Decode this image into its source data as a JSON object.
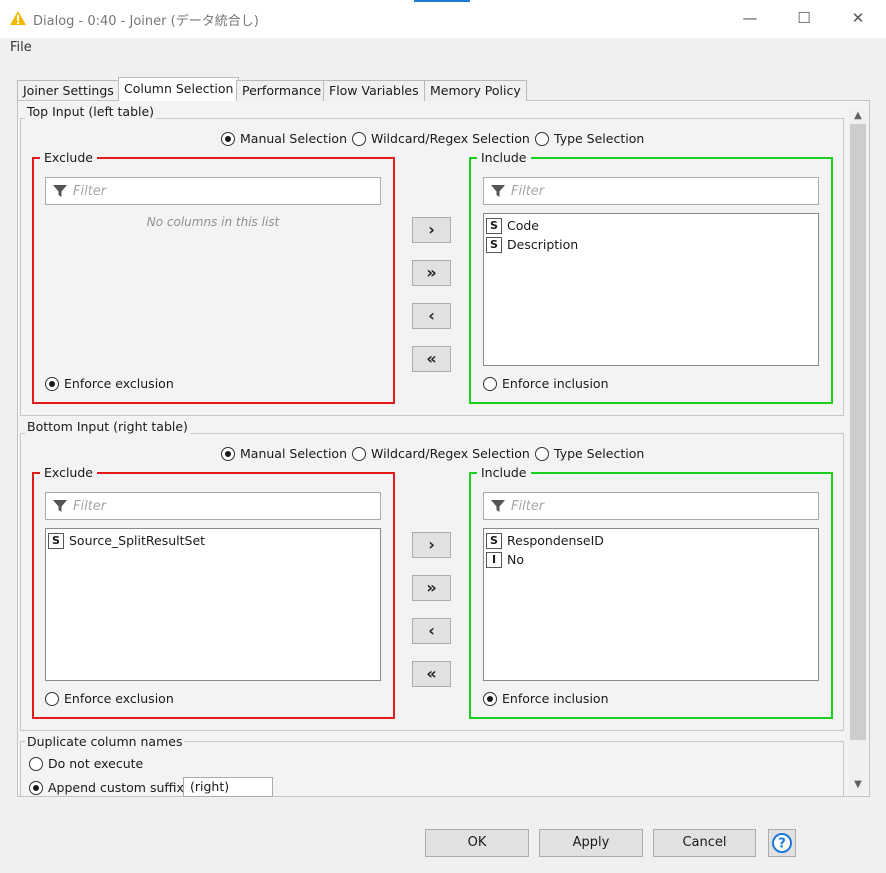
{
  "window": {
    "title": "Dialog - 0:40 - Joiner (データ統合し)",
    "min": "—",
    "max": "☐",
    "close": "✕"
  },
  "menu": {
    "file": "File"
  },
  "tabs": [
    "Joiner Settings",
    "Column Selection",
    "Performance",
    "Flow Variables",
    "Memory Policy"
  ],
  "active_tab": "Column Selection",
  "top": {
    "title": "Top Input (left table)",
    "mode_options": [
      "Manual Selection",
      "Wildcard/Regex Selection",
      "Type Selection"
    ],
    "selected_mode": "Manual Selection",
    "exclude": {
      "label": "Exclude",
      "filter_placeholder": "Filter",
      "empty_message": "No columns in this list",
      "items": [],
      "enforce_label": "Enforce exclusion",
      "enforce_selected": true
    },
    "include": {
      "label": "Include",
      "filter_placeholder": "Filter",
      "items": [
        {
          "type": "S",
          "name": "Code"
        },
        {
          "type": "S",
          "name": "Description"
        }
      ],
      "enforce_label": "Enforce inclusion",
      "enforce_selected": false
    }
  },
  "bottom": {
    "title": "Bottom Input (right table)",
    "mode_options": [
      "Manual Selection",
      "Wildcard/Regex Selection",
      "Type Selection"
    ],
    "selected_mode": "Manual Selection",
    "exclude": {
      "label": "Exclude",
      "filter_placeholder": "Filter",
      "items": [
        {
          "type": "S",
          "name": "Source_SplitResultSet"
        }
      ],
      "enforce_label": "Enforce exclusion",
      "enforce_selected": false
    },
    "include": {
      "label": "Include",
      "filter_placeholder": "Filter",
      "items": [
        {
          "type": "S",
          "name": "RespondenseID"
        },
        {
          "type": "I",
          "name": "No"
        }
      ],
      "enforce_label": "Enforce inclusion",
      "enforce_selected": true
    }
  },
  "arrows": {
    "add": "›",
    "add_all": "»",
    "remove": "‹",
    "remove_all": "«"
  },
  "duplicate": {
    "title": "Duplicate column names",
    "do_not_execute": "Do not execute",
    "append_suffix": "Append custom suffix",
    "suffix_value": "(right)",
    "selected": "append"
  },
  "buttons": {
    "ok": "OK",
    "apply": "Apply",
    "cancel": "Cancel",
    "help": "?"
  },
  "colors": {
    "exclude_border": "#e01b1b",
    "include_border": "#1ccf1c",
    "accent": "#1e78d7"
  }
}
